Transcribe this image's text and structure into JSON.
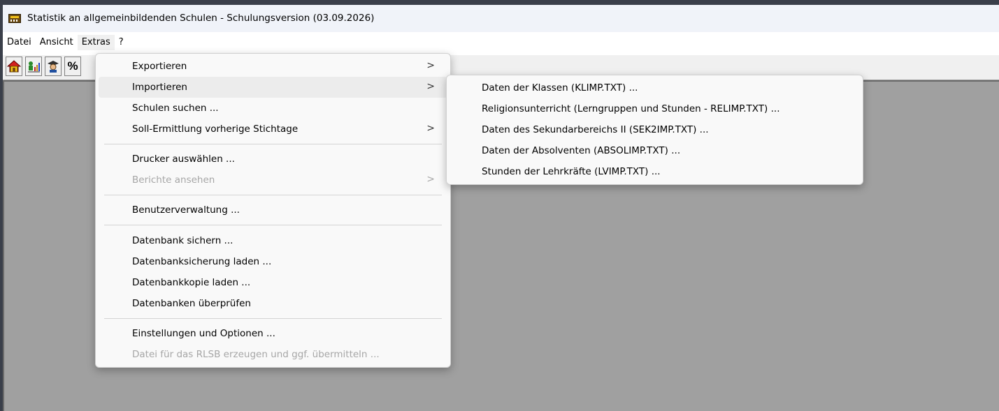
{
  "window": {
    "title": "Statistik an allgemeinbildenden Schulen - Schulungsversion (03.09.2026)"
  },
  "menubar": [
    "Datei",
    "Ansicht",
    "Extras",
    "?"
  ],
  "toolbar": {
    "icons": [
      "house-icon",
      "person-chart-icon",
      "teacher-icon",
      "percent-icon"
    ],
    "percent_label": "%"
  },
  "extras_menu": {
    "items": [
      {
        "label": "Exportieren",
        "submenu": true,
        "enabled": true
      },
      {
        "label": "Importieren",
        "submenu": true,
        "enabled": true,
        "highlighted": true
      },
      {
        "label": "Schulen suchen ...",
        "submenu": false,
        "enabled": true
      },
      {
        "label": "Soll-Ermittlung vorherige Stichtage",
        "submenu": true,
        "enabled": true
      },
      {
        "label": "Drucker auswählen ...",
        "submenu": false,
        "enabled": true
      },
      {
        "label": "Berichte ansehen",
        "submenu": true,
        "enabled": false
      },
      {
        "label": "Benutzerverwaltung ...",
        "submenu": false,
        "enabled": true
      },
      {
        "label": "Datenbank sichern ...",
        "submenu": false,
        "enabled": true
      },
      {
        "label": "Datenbanksicherung laden ...",
        "submenu": false,
        "enabled": true
      },
      {
        "label": "Datenbankkopie laden ...",
        "submenu": false,
        "enabled": true
      },
      {
        "label": "Datenbanken überprüfen",
        "submenu": false,
        "enabled": true
      },
      {
        "label": "Einstellungen und Optionen ...",
        "submenu": false,
        "enabled": true
      },
      {
        "label": "Datei für das RLSB erzeugen und ggf. übermitteln ...",
        "submenu": false,
        "enabled": false
      }
    ],
    "arrow": ">"
  },
  "import_submenu": {
    "items": [
      "Daten der Klassen (KLIMP.TXT) ...",
      "Religionsunterricht (Lerngruppen und Stunden - RELIMP.TXT) ...",
      "Daten des Sekundarbereichs II (SEK2IMP.TXT) ...",
      "Daten der Absolventen (ABSOLIMP.TXT) ...",
      "Stunden der Lehrkräfte (LVIMP.TXT)  ..."
    ]
  },
  "colors": {
    "workspace": "#a0a0a0",
    "menu_bg": "#f9f9f9",
    "highlight": "#ececec",
    "disabled_text": "#a6a6a6"
  }
}
